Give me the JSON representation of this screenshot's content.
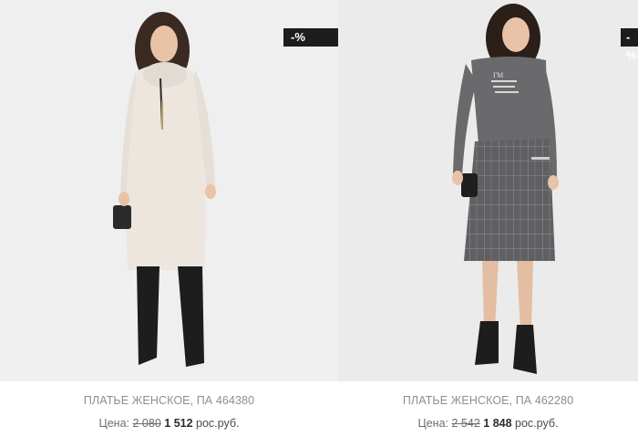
{
  "products": [
    {
      "badge": "-%",
      "title": "ПЛАТЬЕ ЖЕНСКОЕ, ПА 464380",
      "price_label": "Цена:",
      "old_price": "2 080",
      "new_price": "1 512",
      "currency": "рос.руб.",
      "dress_color": "#ece6df",
      "photo_bg": "#efefef"
    },
    {
      "badge": "-%",
      "title": "ПЛАТЬЕ ЖЕНСКОЕ, ПА 462280",
      "price_label": "Цена:",
      "old_price": "2 542",
      "new_price": "1 848",
      "currency": "рос.руб.",
      "dress_color": "#6a6a6c",
      "photo_bg": "#ebebeb"
    }
  ]
}
